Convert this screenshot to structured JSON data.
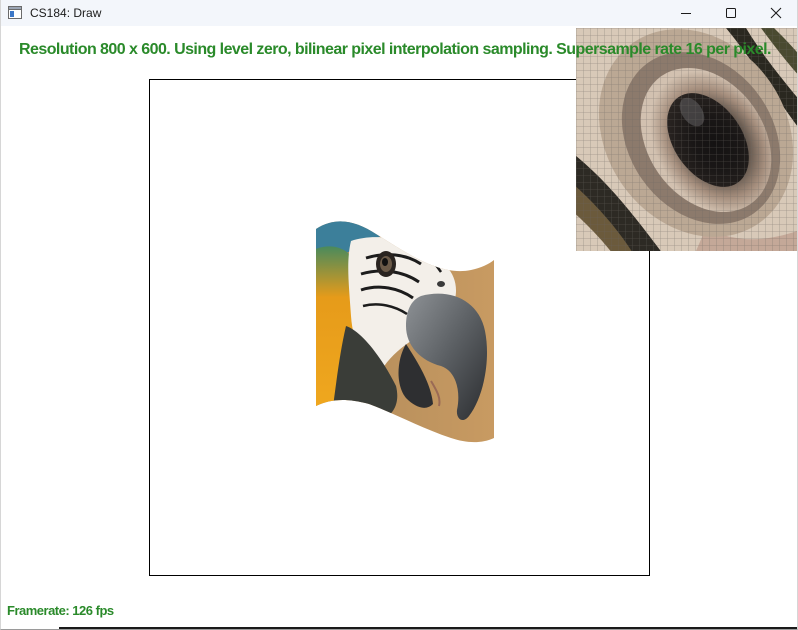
{
  "window": {
    "title": "CS184: Draw"
  },
  "titlebar": {
    "icons": {
      "app": "app-window-icon",
      "minimize": "minimize-icon",
      "maximize": "maximize-icon",
      "close": "close-icon"
    }
  },
  "overlay": {
    "status_text": "Resolution 800 x 600. Using level zero, bilinear pixel interpolation sampling. Supersample rate 16 per pixel.",
    "framerate_text": "Framerate: 126 fps",
    "text_color": "#2a8a2a"
  },
  "canvas": {
    "image_subject": "parrot",
    "zoom_subject": "parrot-eye-zoom"
  }
}
